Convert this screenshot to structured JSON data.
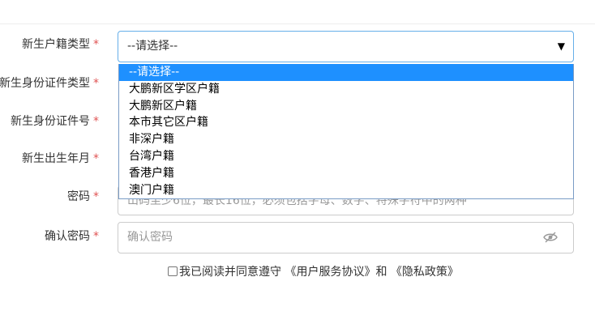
{
  "form": {
    "required_mark": "*",
    "fields": [
      {
        "label": "新生户籍类型"
      },
      {
        "label": "新生身份证件类型"
      },
      {
        "label": "新生身份证件号"
      },
      {
        "label": "新生出生年月"
      },
      {
        "label": "密码"
      },
      {
        "label": "确认密码"
      }
    ],
    "hukou_select": {
      "value": "--请选择--",
      "options": [
        "--请选择--",
        "大鹏新区学区户籍",
        "大鹏新区户籍",
        "本市其它区户籍",
        "非深户籍",
        "台湾户籍",
        "香港户籍",
        "澳门户籍"
      ],
      "highlighted_index": 0
    },
    "password": {
      "partial_hint": "山码至少6位，最长16位，必须包括字母、数字、特殊字符中的两种"
    },
    "confirm_password": {
      "placeholder": "确认密码"
    },
    "agreement": {
      "checked": false,
      "prefix": "我已阅读并同意遵守",
      "service_link": "《用户服务协议》",
      "and": "和",
      "privacy_link": "《隐私政策》"
    }
  },
  "icons": {
    "caret": "caret-down-icon",
    "eye": "eye-slash-icon"
  },
  "colors": {
    "required": "#e05353",
    "focus_border": "#66afe9",
    "option_highlight": "#1e90ff",
    "placeholder": "#999999"
  }
}
